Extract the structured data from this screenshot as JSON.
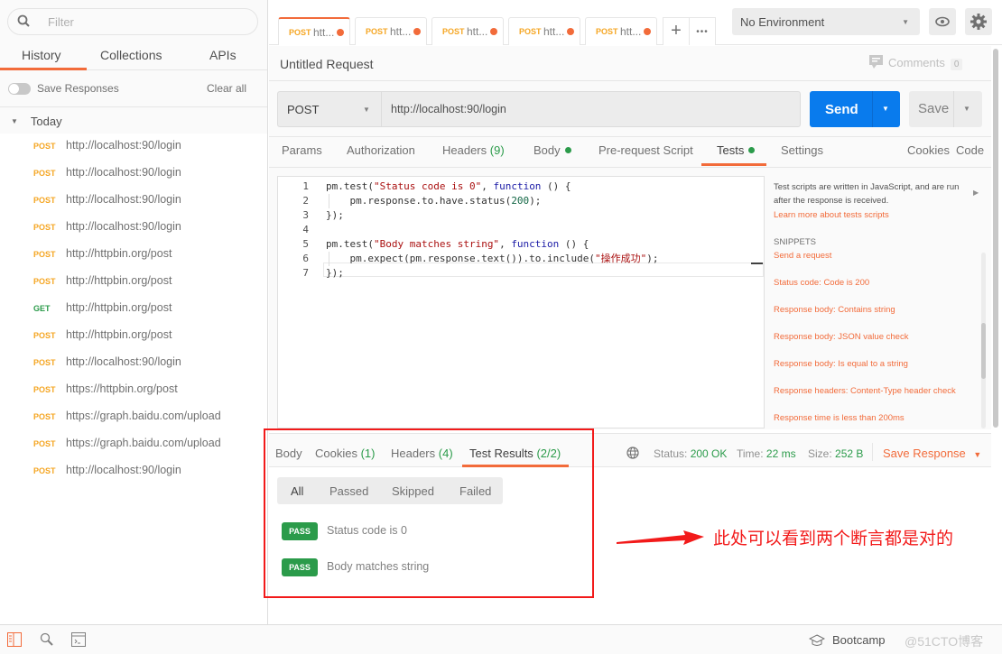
{
  "sidebar": {
    "filter_placeholder": "Filter",
    "tabs": [
      {
        "label": "History",
        "active": true
      },
      {
        "label": "Collections"
      },
      {
        "label": "APIs"
      }
    ],
    "save_responses_label": "Save Responses",
    "save_responses_on": false,
    "clear_all_label": "Clear all",
    "group_label": "Today",
    "history": [
      {
        "method": "POST",
        "url": "http://localhost:90/login"
      },
      {
        "method": "POST",
        "url": "http://localhost:90/login"
      },
      {
        "method": "POST",
        "url": "http://localhost:90/login"
      },
      {
        "method": "POST",
        "url": "http://localhost:90/login"
      },
      {
        "method": "POST",
        "url": "http://httpbin.org/post"
      },
      {
        "method": "POST",
        "url": "http://httpbin.org/post"
      },
      {
        "method": "GET",
        "url": "http://httpbin.org/post"
      },
      {
        "method": "POST",
        "url": "http://httpbin.org/post"
      },
      {
        "method": "POST",
        "url": "http://localhost:90/login"
      },
      {
        "method": "POST",
        "url": "https://httpbin.org/post"
      },
      {
        "method": "POST",
        "url": "https://graph.baidu.com/upload"
      },
      {
        "method": "POST",
        "url": "https://graph.baidu.com/upload"
      },
      {
        "method": "POST",
        "url": "http://localhost:90/login"
      }
    ]
  },
  "request_tabs": [
    {
      "method": "POST",
      "label": "htt...",
      "active": true
    },
    {
      "method": "POST",
      "label": "htt..."
    },
    {
      "method": "POST",
      "label": "htt..."
    },
    {
      "method": "POST",
      "label": "htt..."
    },
    {
      "method": "POST",
      "label": "htt..."
    }
  ],
  "toolbar": {
    "add_tab": "+",
    "more": "•••",
    "environment": "No Environment"
  },
  "request": {
    "title": "Untitled Request",
    "comments_label": "Comments",
    "comments_count": "0",
    "method": "POST",
    "url": "http://localhost:90/login",
    "send_label": "Send",
    "save_label": "Save",
    "tabs": {
      "params": "Params",
      "authorization": "Authorization",
      "headers": "Headers",
      "headers_count": "(9)",
      "body": "Body",
      "prerequest": "Pre-request Script",
      "tests": "Tests",
      "settings": "Settings",
      "cookies": "Cookies",
      "code": "Code"
    }
  },
  "editor": {
    "lines": [
      {
        "n": "1",
        "parts": [
          [
            "",
            "pm.test("
          ],
          [
            "str",
            "\"Status code is 0\""
          ],
          [
            "",
            ", "
          ],
          [
            "kw",
            "function"
          ],
          [
            "",
            " () {"
          ]
        ]
      },
      {
        "n": "2",
        "parts": [
          [
            "",
            "    pm.response.to.have.status("
          ],
          [
            "num",
            "200"
          ],
          [
            "",
            ");"
          ]
        ]
      },
      {
        "n": "3",
        "parts": [
          [
            "",
            "});"
          ]
        ]
      },
      {
        "n": "4",
        "parts": []
      },
      {
        "n": "5",
        "parts": [
          [
            "",
            "pm.test("
          ],
          [
            "str",
            "\"Body matches string\""
          ],
          [
            "",
            ", "
          ],
          [
            "kw",
            "function"
          ],
          [
            "",
            " () {"
          ]
        ]
      },
      {
        "n": "6",
        "parts": [
          [
            "",
            "    pm.expect(pm.response.text()).to.include("
          ],
          [
            "str",
            "\"操作成功\""
          ],
          [
            "",
            ");"
          ]
        ]
      },
      {
        "n": "7",
        "parts": [
          [
            "",
            "});"
          ]
        ]
      }
    ]
  },
  "snippets": {
    "description": "Test scripts are written in JavaScript, and are run after the response is received.",
    "learn_more": "Learn more about tests scripts",
    "heading": "SNIPPETS",
    "items": [
      "Send a request",
      "Status code: Code is 200",
      "Response body: Contains string",
      "Response body: JSON value check",
      "Response body: Is equal to a string",
      "Response headers: Content-Type header check",
      "Response time is less than 200ms"
    ]
  },
  "response": {
    "tabs": {
      "body": "Body",
      "cookies": "Cookies",
      "cookies_count": "(1)",
      "headers": "Headers",
      "headers_count": "(4)",
      "test_results": "Test Results",
      "test_results_count": "(2/2)"
    },
    "status_label": "Status:",
    "status": "200 OK",
    "time_label": "Time:",
    "time": "22 ms",
    "size_label": "Size:",
    "size": "252 B",
    "save_response": "Save Response",
    "filters": [
      "All",
      "Passed",
      "Skipped",
      "Failed"
    ],
    "results": [
      {
        "status": "PASS",
        "name": "Status code is 0"
      },
      {
        "status": "PASS",
        "name": "Body matches string"
      }
    ]
  },
  "annotation": "此处可以看到两个断言都是对的",
  "bottom": {
    "bootcamp": "Bootcamp",
    "watermark": "@51CTO博客"
  }
}
